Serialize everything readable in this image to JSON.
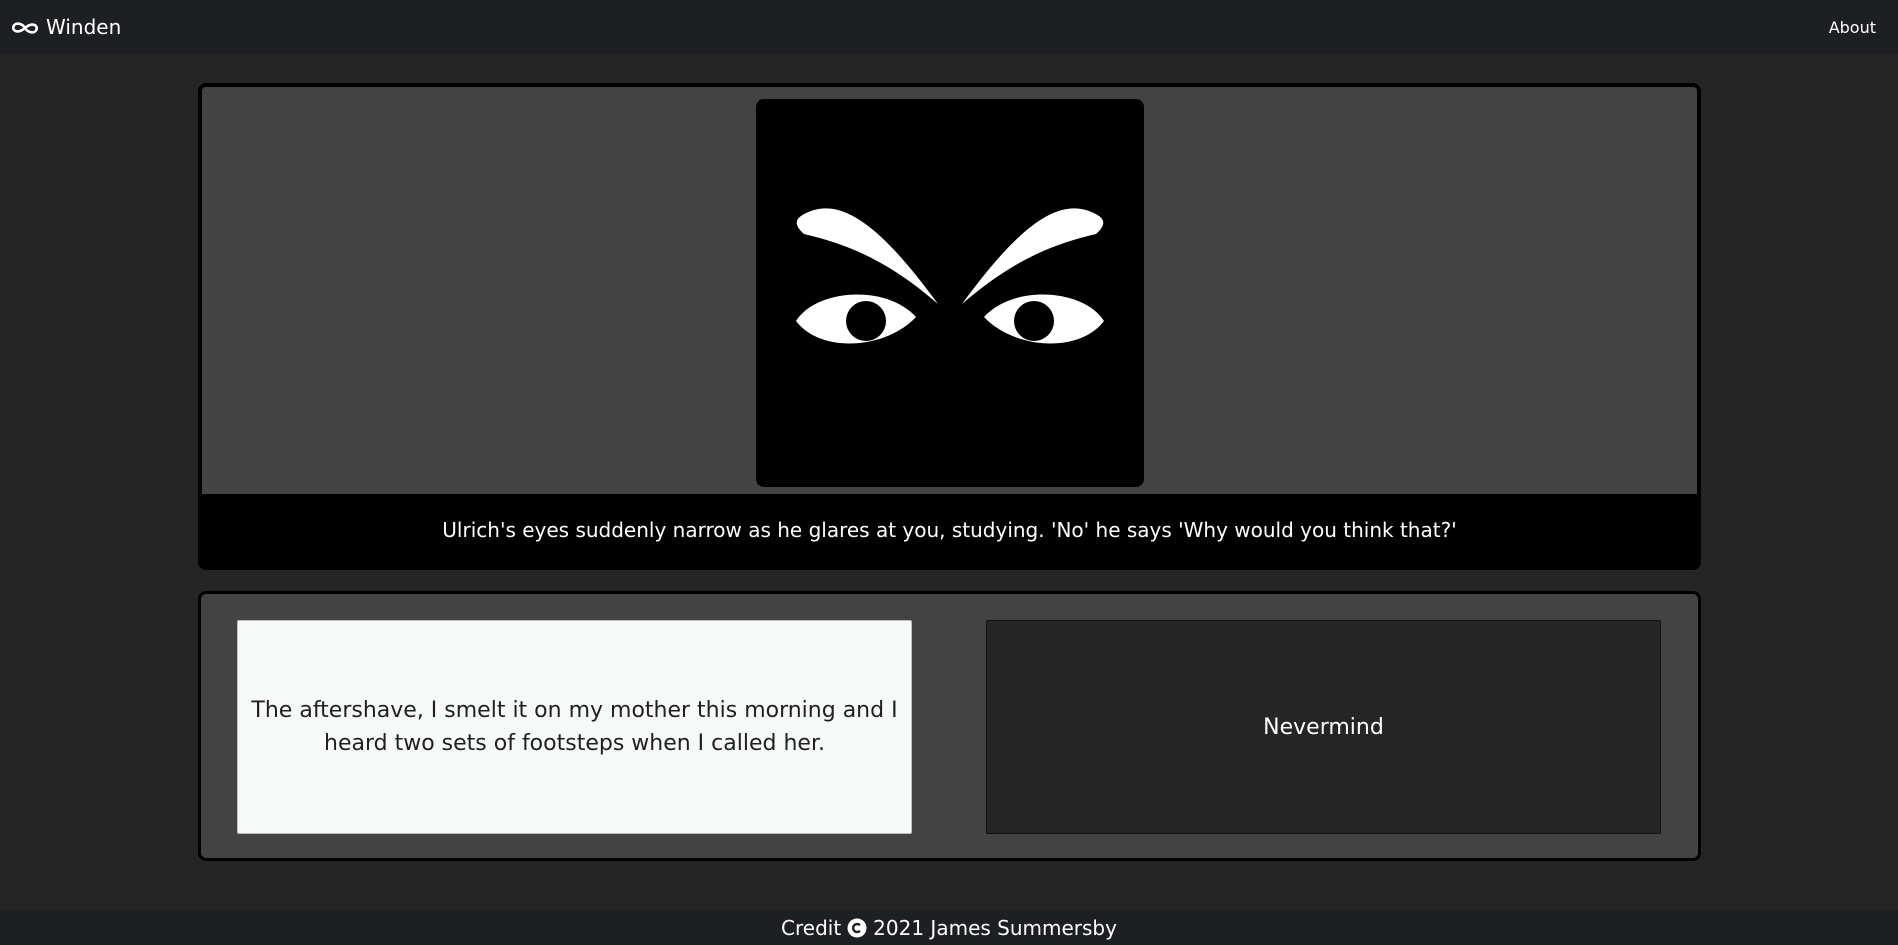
{
  "navbar": {
    "brand_icon": "infinity-icon",
    "brand_label": "Winden",
    "about_label": "About"
  },
  "story": {
    "image_icon": "glaring-eyes-icon",
    "text": "Ulrich's eyes suddenly narrow as he glares at you, studying. 'No' he says 'Why would you think that?'"
  },
  "choices": [
    {
      "label": "The aftershave, I smelt it on my mother this morning and I heard two sets of footsteps when I called her."
    },
    {
      "label": "Nevermind"
    }
  ],
  "footer": {
    "credit_prefix": "Credit",
    "copyright_icon": "copyright-icon",
    "credit_text": "2021 James Summersby"
  },
  "colors": {
    "page_background": "#252525",
    "navbar_background": "#1e1f22",
    "panel_background": "#434343",
    "light_choice": "#f7f9f8",
    "dark_choice": "#262626"
  }
}
